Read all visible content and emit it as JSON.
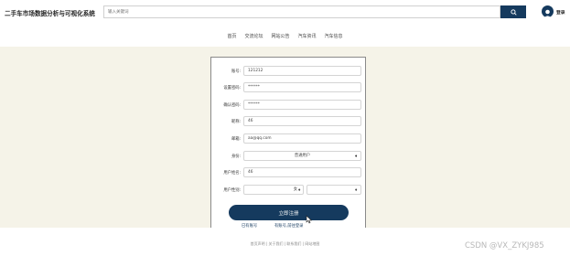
{
  "header": {
    "site_title": "二手车市场数据分析与可视化系统",
    "search_placeholder": "输入关键词",
    "login_label": "登录"
  },
  "nav": {
    "items": [
      "首页",
      "交流论坛",
      "网站公告",
      "汽车资讯",
      "汽车信息"
    ]
  },
  "form": {
    "account_label": "账号:",
    "account_value": "121212",
    "password_label": "设置密码:",
    "password_value": "******",
    "confirm_label": "确认密码:",
    "confirm_value": "******",
    "nickname_label": "昵称:",
    "nickname_value": "46",
    "email_label": "邮箱:",
    "email_value": "aa@qq.com",
    "identity_label": "身份:",
    "identity_value": "普通用户",
    "username_label": "用户姓名:",
    "username_value": "46",
    "gender_label": "用户性别:",
    "gender_value": "女",
    "register_label": "立即注册",
    "existing_link": "已有账号",
    "goto_login_link": "有账号,前往登录"
  },
  "footer": {
    "links": "首页声明 | 关于我们 | 联系我们 | 网站地图"
  },
  "watermark": "CSDN @VX_ZYKJ985",
  "colors": {
    "primary": "#153a5e",
    "main_bg": "#f5f3e8"
  }
}
